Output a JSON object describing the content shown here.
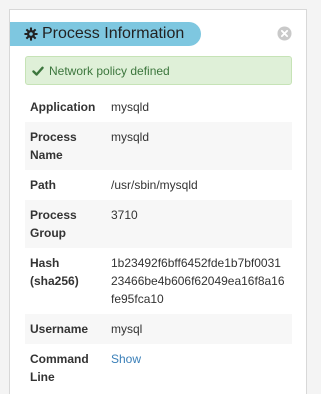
{
  "panel": {
    "title": "Process Information",
    "title_icon": "gear-icon",
    "close_icon": "close-icon",
    "accent_color": "#7ec7e0"
  },
  "alert": {
    "icon": "check-icon",
    "text": "Network policy defined",
    "color": "#3c763d",
    "background": "#dff0d8"
  },
  "rows": [
    {
      "label": "Application",
      "value": "mysqld"
    },
    {
      "label": "Process Name",
      "value": "mysqld"
    },
    {
      "label": "Path",
      "value": "/usr/sbin/mysqld"
    },
    {
      "label": "Process Group",
      "value": "3710"
    },
    {
      "label": "Hash (sha256)",
      "value": "1b23492f6bff6452fde1b7bf003123466be4b606f62049ea16f8a16fe95fca10"
    },
    {
      "label": "Username",
      "value": "mysql"
    },
    {
      "label": "Command Line",
      "value": "Show"
    }
  ]
}
